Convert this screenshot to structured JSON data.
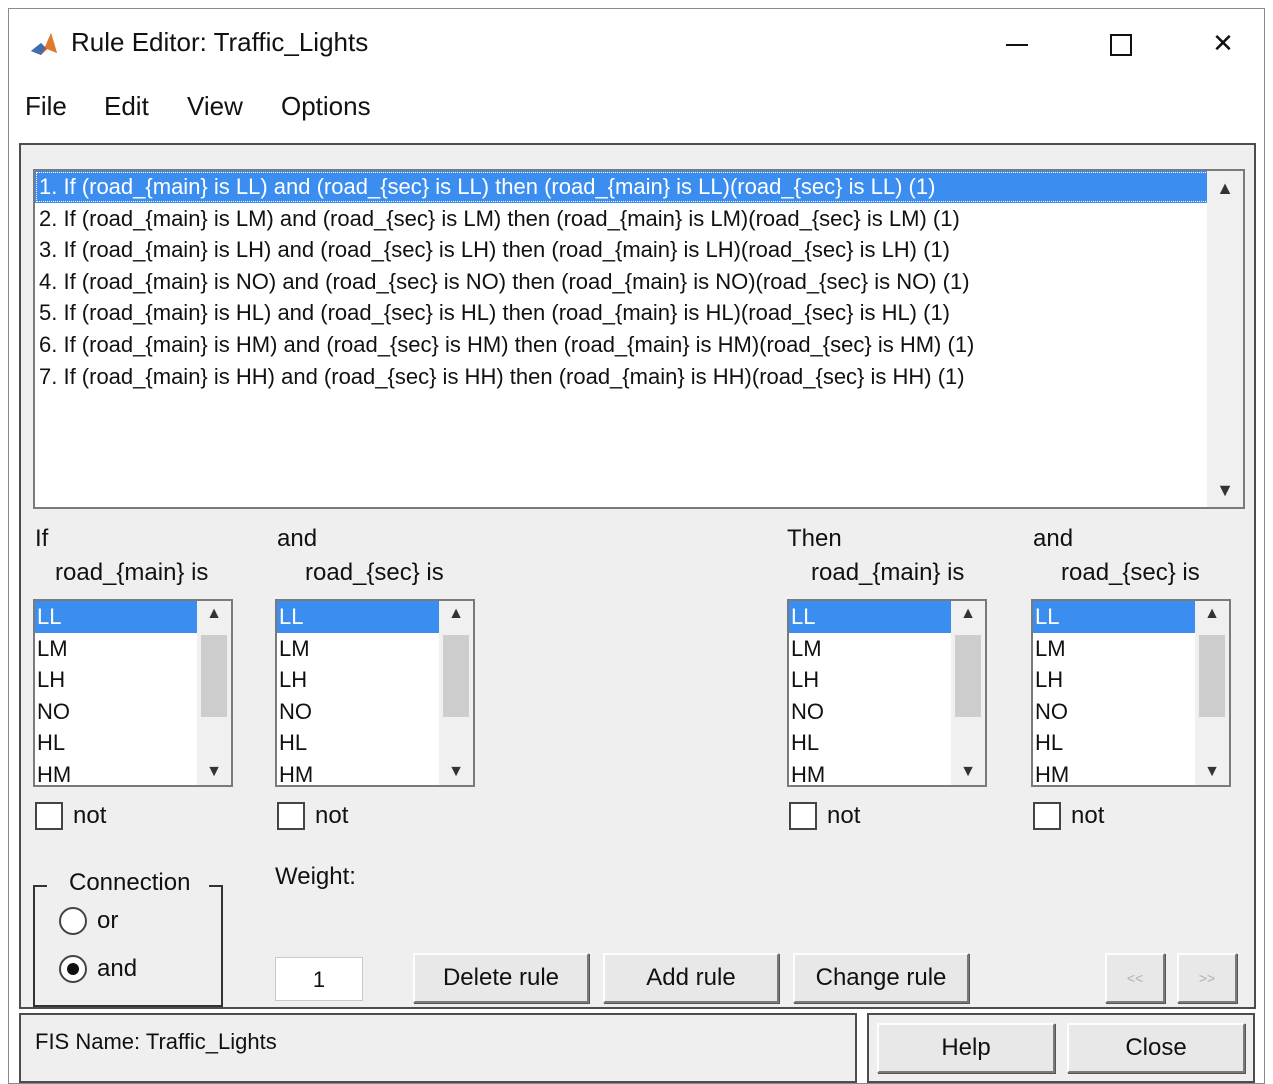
{
  "window": {
    "title": "Rule Editor: Traffic_Lights",
    "minimize_icon": "minimize-icon",
    "maximize_icon": "maximize-icon",
    "close_glyph": "✕"
  },
  "menu": [
    "File",
    "Edit",
    "View",
    "Options"
  ],
  "rules": [
    "1. If (road_{main} is LL) and (road_{sec} is LL) then (road_{main} is LL)(road_{sec} is LL) (1)",
    "2. If (road_{main} is LM) and (road_{sec} is LM) then (road_{main} is LM)(road_{sec} is LM) (1)",
    "3. If (road_{main} is LH) and (road_{sec} is LH) then (road_{main} is LH)(road_{sec} is LH) (1)",
    "4. If (road_{main} is NO) and (road_{sec} is NO) then (road_{main} is NO)(road_{sec} is NO) (1)",
    "5. If (road_{main} is HL) and (road_{sec} is HL) then (road_{main} is HL)(road_{sec} is HL) (1)",
    "6. If (road_{main} is HM) and (road_{sec} is HM) then (road_{main} is HM)(road_{sec} is HM) (1)",
    "7. If (road_{main} is HH) and (road_{sec} is HH) then (road_{main} is HH)(road_{sec} is HH) (1)"
  ],
  "selected_rule_index": 0,
  "columns": [
    {
      "connector": "If",
      "variable": "road_{main} is",
      "options": [
        "LL",
        "LM",
        "LH",
        "NO",
        "HL",
        "HM"
      ],
      "selected": "LL",
      "not_label": "not",
      "not_checked": false
    },
    {
      "connector": "and",
      "variable": "road_{sec} is",
      "options": [
        "LL",
        "LM",
        "LH",
        "NO",
        "HL",
        "HM"
      ],
      "selected": "LL",
      "not_label": "not",
      "not_checked": false
    },
    {
      "connector": "Then",
      "variable": "road_{main} is",
      "options": [
        "LL",
        "LM",
        "LH",
        "NO",
        "HL",
        "HM"
      ],
      "selected": "LL",
      "not_label": "not",
      "not_checked": false
    },
    {
      "connector": "and",
      "variable": "road_{sec} is",
      "options": [
        "LL",
        "LM",
        "LH",
        "NO",
        "HL",
        "HM"
      ],
      "selected": "LL",
      "not_label": "not",
      "not_checked": false
    }
  ],
  "connection": {
    "title": "Connection",
    "options": [
      "or",
      "and"
    ],
    "selected": "and"
  },
  "weight": {
    "label": "Weight:",
    "value": "1"
  },
  "buttons": {
    "delete_rule": "Delete rule",
    "add_rule": "Add rule",
    "change_rule": "Change rule",
    "prev": "<<",
    "next": ">>",
    "help": "Help",
    "close": "Close"
  },
  "status": "FIS Name: Traffic_Lights",
  "colors": {
    "selection": "#3b8ef0",
    "panel_bg": "#efefef"
  }
}
